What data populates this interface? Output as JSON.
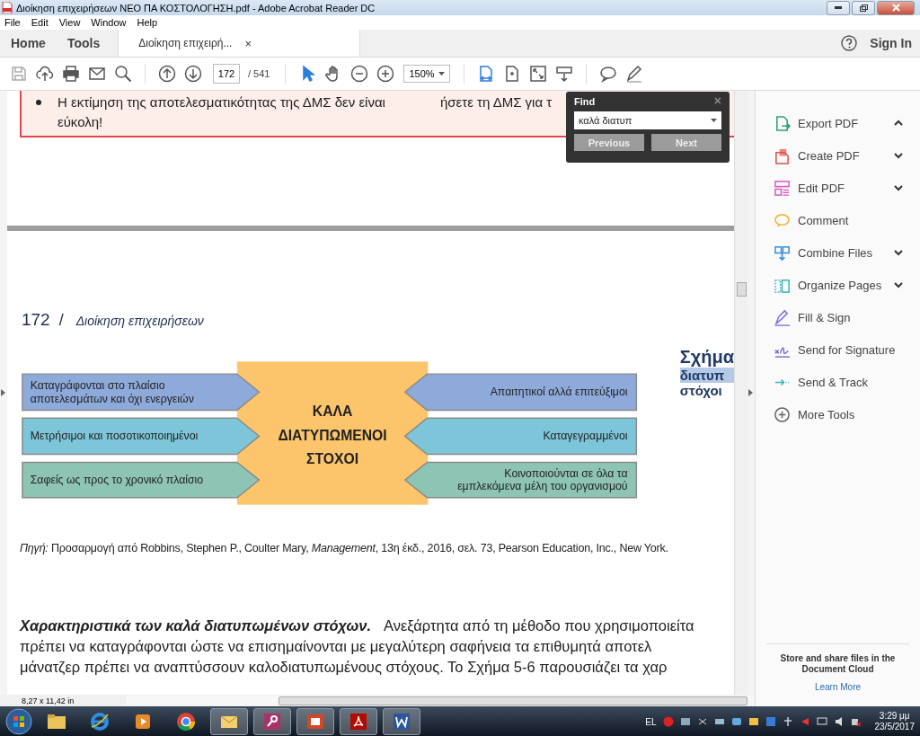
{
  "window": {
    "title": "Διοίκηση επιχειρήσεων ΝΕΟ ΠΑ ΚΟΣΤΟΛΟΓΗΣΗ.pdf - Adobe Acrobat Reader DC"
  },
  "menu": [
    "File",
    "Edit",
    "View",
    "Window",
    "Help"
  ],
  "nav_tabs": [
    {
      "label": "Home",
      "selected": false
    },
    {
      "label": "Tools",
      "selected": false
    }
  ],
  "document_tab": {
    "label": "Διοίκηση επιχειρή...",
    "close": "×",
    "selected": true
  },
  "sign_in": "Sign In",
  "toolbar": {
    "page": "172",
    "page_count": "/ 541",
    "zoom": "150%"
  },
  "document": {
    "previous_page": {
      "bullet_lines": [
        "Η εκτίμηση της αποτελεσματικότητας της ΔΜΣ δεν είναι",
        "εύκολη!"
      ],
      "right_text": "ήσετε τη ΔΜΣ για τ"
    },
    "page_header": {
      "number": "172",
      "separator": "/",
      "title": "Διοίκηση επιχειρήσεων"
    },
    "figure_title": [
      "Σχήμα",
      "διατυπ",
      "στόχοι"
    ],
    "diagram": {
      "center": [
        "ΚΑΛΑ",
        "ΔΙΑΤΥΠΩΜΕΝΟΙ",
        "ΣΤΟΧΟΙ"
      ],
      "left_items": [
        {
          "lines": [
            "Καταγράφονται στο πλαίσιο",
            "αποτελεσμάτων και όχι ενεργειών"
          ],
          "color": "#8eaadb"
        },
        {
          "lines": [
            "Μετρήσιμοι και ποσοτικοποιημένοι"
          ],
          "color": "#7dc5d8"
        },
        {
          "lines": [
            "Σαφείς ως προς το χρονικό πλαίσιο"
          ],
          "color": "#8ec4b4"
        }
      ],
      "right_items": [
        {
          "lines": [
            "Απαιτητικοί αλλά επιτεύξιμοι"
          ],
          "color": "#8eaadb"
        },
        {
          "lines": [
            "Καταγεγραμμένοι"
          ],
          "color": "#7dc5d8"
        },
        {
          "lines": [
            "Κοινοποιούνται σε όλα τα",
            "εμπλεκόμενα μέλη του οργανισμού"
          ],
          "color": "#8ec4b4"
        }
      ]
    },
    "source": "*Πηγή:* Προσαρμογή από Robbins, Stephen P., Coulter Mary, *Management*, 13η έκδ., 2016, σελ. 73, Pearson Education, Inc., New York.",
    "paragraph": {
      "heading": "Χαρακτηριστικά των καλά διατυπωμένων στόχων.",
      "lines": [
        "Ανεξάρτητα από τη μέθοδο που χρησιμοποιείτα",
        "πρέπει να καταγράφονται ώστε να επισημαίνονται με μεγαλύτερη σαφήνεια τα επιθυμητά αποτελ",
        "μάνατζερ πρέπει να αναπτύσσουν καλοδιατυπωμένους στόχους. Το Σχήμα 5-6 παρουσιάζει τα χαρ"
      ]
    }
  },
  "find": {
    "title": "Find",
    "close": "×",
    "value": "καλά διατυπ",
    "buttons": [
      "Previous",
      "Next"
    ]
  },
  "sidebar": {
    "items": [
      {
        "label": "Export PDF",
        "kind": "expandable",
        "expanded": true
      },
      {
        "label": "Create PDF",
        "kind": "expandable",
        "expanded": false
      },
      {
        "label": "Edit PDF",
        "kind": "expandable",
        "expanded": false
      },
      {
        "label": "Comment",
        "kind": "plain"
      },
      {
        "label": "Combine Files",
        "kind": "expandable",
        "expanded": false
      },
      {
        "label": "Organize Pages",
        "kind": "expandable",
        "expanded": false
      },
      {
        "label": "Fill & Sign",
        "kind": "plain"
      },
      {
        "label": "Send for Signature",
        "kind": "plain"
      },
      {
        "label": "Send & Track",
        "kind": "plain"
      },
      {
        "label": "More Tools",
        "kind": "plain"
      }
    ],
    "promo": "Store and share files in the Document Cloud",
    "promo_link": "Learn More"
  },
  "status_bar": {
    "page_size": "8,27 x 11,42 in"
  },
  "taskbar": {
    "language": "EL",
    "time": "3:29 μμ",
    "date": "23/5/2017"
  }
}
